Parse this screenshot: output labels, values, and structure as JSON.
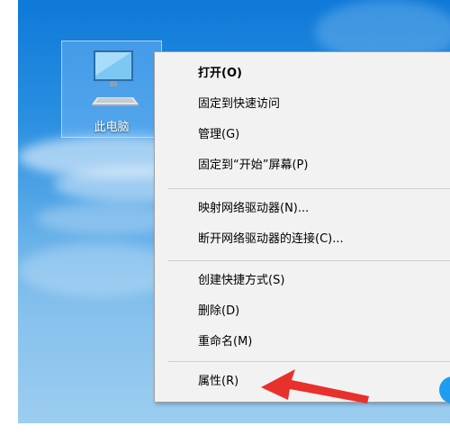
{
  "desktop": {
    "icon_label": "此电脑"
  },
  "context_menu": {
    "items": [
      {
        "label": "打开(O)"
      },
      {
        "label": "固定到快速访问"
      },
      {
        "label": "管理(G)"
      },
      {
        "label": "固定到“开始”屏幕(P)"
      },
      {
        "label": "映射网络驱动器(N)..."
      },
      {
        "label": "断开网络驱动器的连接(C)..."
      },
      {
        "label": "创建快捷方式(S)"
      },
      {
        "label": "删除(D)"
      },
      {
        "label": "重命名(M)"
      },
      {
        "label": "属性(R)"
      }
    ]
  },
  "annotation": {
    "arrow_color": "#e8302c"
  }
}
